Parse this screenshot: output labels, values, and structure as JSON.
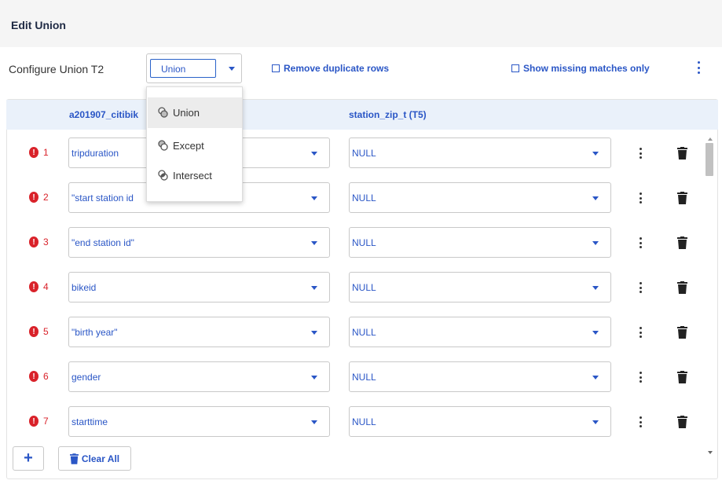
{
  "header": {
    "title": "Edit Union"
  },
  "config": {
    "label": "Configure Union T2",
    "selected_op": "Union",
    "remove_duplicates": "Remove duplicate rows",
    "show_missing": "Show missing matches only"
  },
  "table": {
    "col_left": "a201907_citibik",
    "col_right": "station_zip_t (T5)",
    "rows": [
      {
        "num": "1",
        "left": "tripduration",
        "right": "NULL"
      },
      {
        "num": "2",
        "left": "\"start station id",
        "right": "NULL"
      },
      {
        "num": "3",
        "left": "\"end station id\"",
        "right": "NULL"
      },
      {
        "num": "4",
        "left": "bikeid",
        "right": "NULL"
      },
      {
        "num": "5",
        "left": "\"birth year\"",
        "right": "NULL"
      },
      {
        "num": "6",
        "left": "gender",
        "right": "NULL"
      },
      {
        "num": "7",
        "left": "starttime",
        "right": "NULL"
      }
    ]
  },
  "footer": {
    "add_label": "+",
    "clear_label": "Clear All"
  },
  "dropdown": {
    "options": [
      {
        "label": "Union",
        "icon": "set-union-icon",
        "active": true
      },
      {
        "label": "Except",
        "icon": "set-except-icon",
        "active": false
      },
      {
        "label": "Intersect",
        "icon": "set-intersect-icon",
        "active": false
      }
    ]
  },
  "colors": {
    "accent": "#2a56c6",
    "error": "#d9222a",
    "header_bg": "#eaf1fa"
  }
}
